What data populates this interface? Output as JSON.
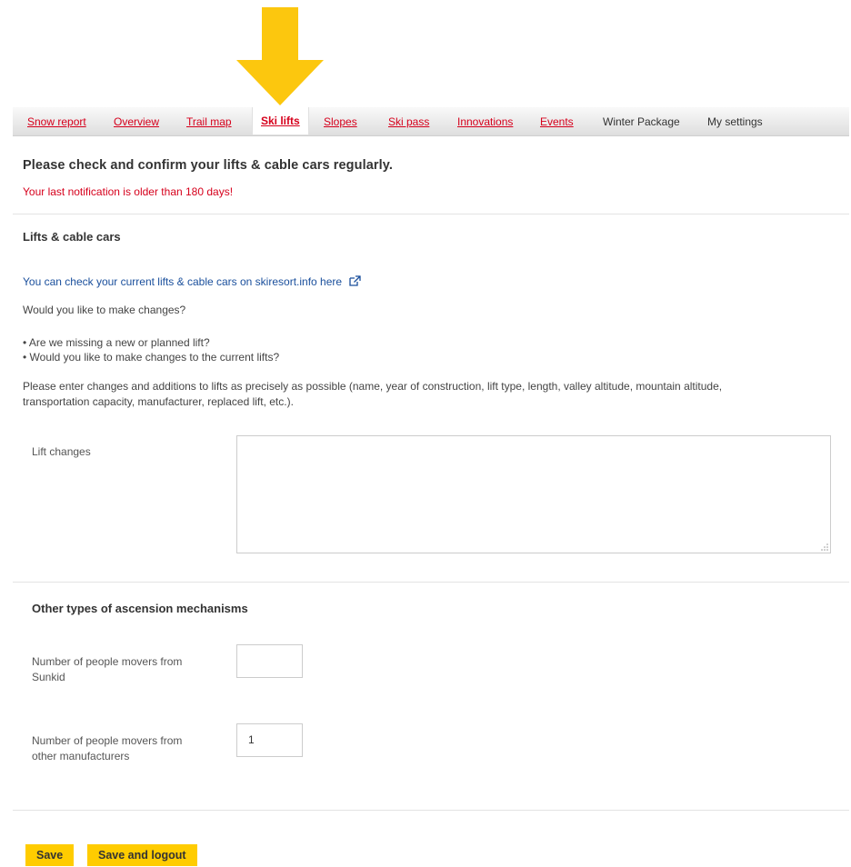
{
  "nav": {
    "items": [
      {
        "label": "Snow report"
      },
      {
        "label": "Overview"
      },
      {
        "label": "Trail map"
      },
      {
        "label": "Ski lifts"
      },
      {
        "label": "Slopes"
      },
      {
        "label": "Ski pass"
      },
      {
        "label": "Innovations"
      },
      {
        "label": "Events"
      },
      {
        "label": "Winter Package"
      },
      {
        "label": "My settings"
      }
    ],
    "active": "Ski lifts"
  },
  "notice": {
    "title": "Please check and confirm your lifts & cable cars regularly.",
    "warning": "Your last notification is older than 180 days!"
  },
  "lifts": {
    "heading": "Lifts & cable cars",
    "link_text": "You can check your current lifts & cable cars on skiresort.info here",
    "question": "Would you like to make changes?",
    "bullets": [
      "• Are we missing a new or planned lift?",
      "• Would you like to make changes to the current lifts?"
    ],
    "instructions_line1": "Please enter changes and additions to lifts as precisely as possible (name, year of construction, lift type, length, valley altitude, mountain altitude,",
    "instructions_line2": "transportation capacity, manufacturer, replaced lift, etc.).",
    "changes_label": "Lift changes",
    "changes_value": ""
  },
  "ascension": {
    "heading": "Other types of ascension mechanisms",
    "sunkid_label_line1": "Number of people movers from",
    "sunkid_label_line2": "Sunkid",
    "sunkid_value": "",
    "other_label_line1": "Number of people movers from",
    "other_label_line2": "other manufacturers",
    "other_value": "1"
  },
  "actions": {
    "save": "Save",
    "save_logout": "Save and logout"
  },
  "colors": {
    "accent_yellow": "#ffcc00",
    "nav_link_red": "#d6001c",
    "link_blue": "#1a4f9c"
  }
}
